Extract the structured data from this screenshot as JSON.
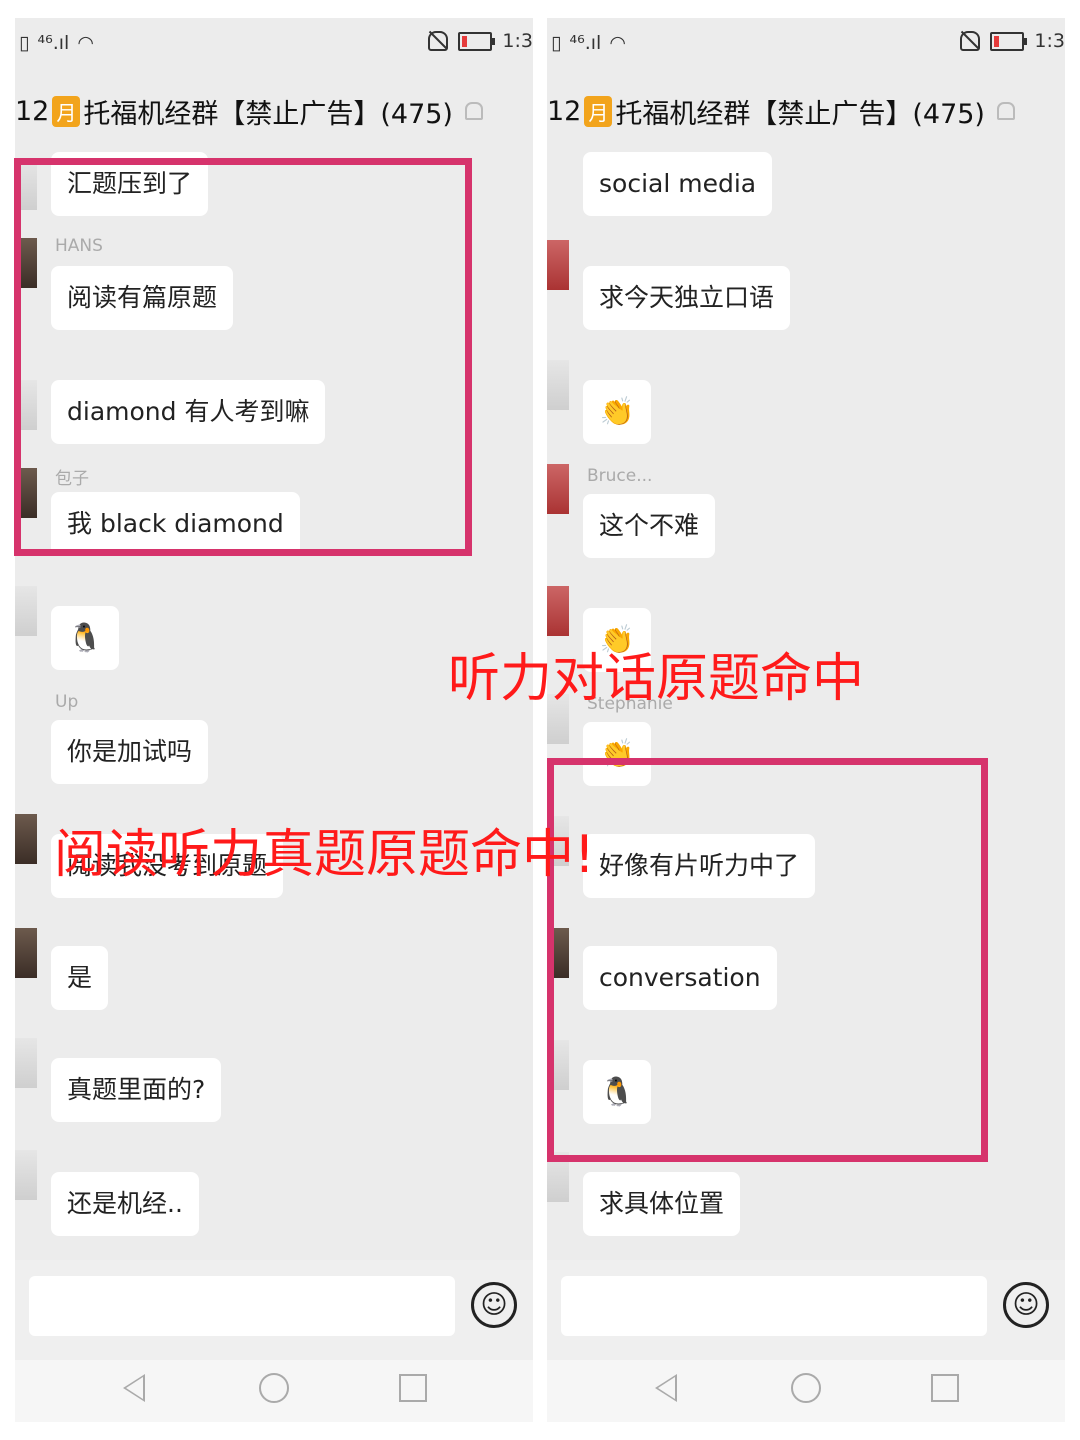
{
  "status": {
    "network": "⁴⁶.ıl",
    "time": "1:3"
  },
  "header": {
    "month_num": "12",
    "month_badge": "月",
    "group_name": "托福机经群【禁止广告】(475)"
  },
  "left_panel": {
    "senders": [
      "HANS",
      "包子",
      "Up"
    ],
    "messages": [
      "汇题压到了",
      "阅读有篇原题",
      "diamond 有人考到嘛",
      "我 black diamond",
      "你是加试吗",
      "阅读我没考到原题",
      "是",
      "真题里面的?",
      "还是机经.."
    ]
  },
  "right_panel": {
    "senders": [
      "Bruce...",
      "Stephanie"
    ],
    "messages": [
      "social media",
      "求今天独立口语",
      "这个不难",
      "好像有片听力中了",
      "conversation",
      "求具体位置"
    ]
  },
  "annotations": {
    "reading_listening_hit": "阅读听力真题原题命中!",
    "listening_dialog_hit": "听力对话原题命中"
  },
  "input": {
    "emoji_icon": "☺"
  },
  "colors": {
    "frame": "#d6336c",
    "annotation_text": "#ff1a1a",
    "badge": "#f2a41c"
  }
}
